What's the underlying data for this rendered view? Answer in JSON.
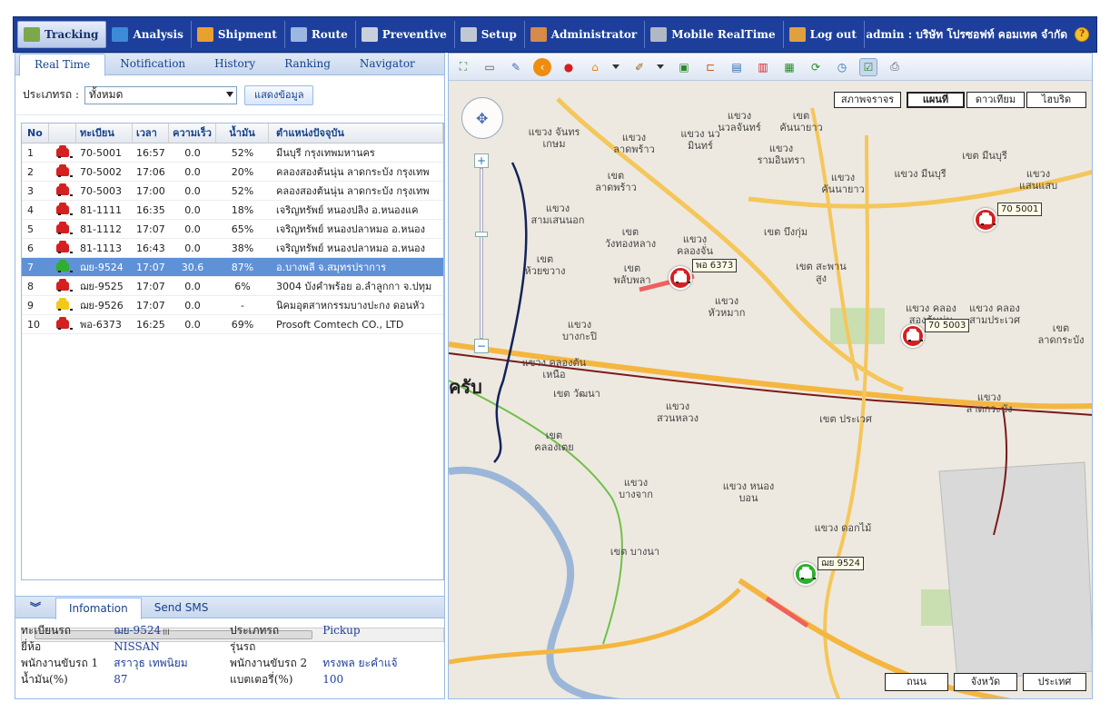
{
  "nav": {
    "items": [
      {
        "label": "Tracking",
        "color": "#7aa84a"
      },
      {
        "label": "Analysis",
        "color": "#3d8bd8"
      },
      {
        "label": "Shipment",
        "color": "#e8a030"
      },
      {
        "label": "Route",
        "color": "#9ab8e0"
      },
      {
        "label": "Preventive",
        "color": "#c8d0dc"
      },
      {
        "label": "Setup",
        "color": "#c0c8d4"
      },
      {
        "label": "Administrator",
        "color": "#d88a4a"
      },
      {
        "label": "Mobile RealTime",
        "color": "#b0b8c4"
      },
      {
        "label": "Log out",
        "color": "#e0a040"
      }
    ],
    "user": "admin : บริษัท โปรซอฟท์ คอมเทค จำกัด"
  },
  "left_tabs": [
    "Real Time",
    "Notification",
    "History",
    "Ranking",
    "Navigator"
  ],
  "filter": {
    "label": "ประเภทรถ :",
    "selected": "ทั้งหมด",
    "button": "แสดงข้อมูล"
  },
  "grid": {
    "headers": [
      "No",
      "",
      "ทะเบียน",
      "เวลา",
      "ความเร็ว",
      "น้ำมัน",
      "ตำแหน่งปัจจุบัน"
    ],
    "rows": [
      {
        "no": "1",
        "color": "#d42020",
        "plate": "70-5001",
        "time": "16:57",
        "speed": "0.0",
        "fuel": "52%",
        "loc": "มีนบุรี กรุงเทพมหานคร"
      },
      {
        "no": "2",
        "color": "#d42020",
        "plate": "70-5002",
        "time": "17:06",
        "speed": "0.0",
        "fuel": "20%",
        "loc": "คลองสองต้นนุ่น ลาดกระบัง กรุงเทพ"
      },
      {
        "no": "3",
        "color": "#d42020",
        "plate": "70-5003",
        "time": "17:00",
        "speed": "0.0",
        "fuel": "52%",
        "loc": "คลองสองต้นนุ่น ลาดกระบัง กรุงเทพ"
      },
      {
        "no": "4",
        "color": "#d42020",
        "plate": "81-1111",
        "time": "16:35",
        "speed": "0.0",
        "fuel": "18%",
        "loc": "เจริญทรัพย์ หนองปลิง อ.หนองแค"
      },
      {
        "no": "5",
        "color": "#d42020",
        "plate": "81-1112",
        "time": "17:07",
        "speed": "0.0",
        "fuel": "65%",
        "loc": "เจริญทรัพย์ หนองปลาหมอ อ.หนอง"
      },
      {
        "no": "6",
        "color": "#d42020",
        "plate": "81-1113",
        "time": "16:43",
        "speed": "0.0",
        "fuel": "38%",
        "loc": "เจริญทรัพย์ หนองปลาหมอ อ.หนอง"
      },
      {
        "no": "7",
        "color": "#2fae2f",
        "plate": "ฌย-9524",
        "time": "17:07",
        "speed": "30.6",
        "fuel": "87%",
        "loc": "อ.บางพลี จ.สมุทรปราการ",
        "selected": true
      },
      {
        "no": "8",
        "color": "#d42020",
        "plate": "ฌย-9525",
        "time": "17:07",
        "speed": "0.0",
        "fuel": "6%",
        "loc": "3004 บังคำพร้อย อ.ลำลูกกา จ.ปทุม"
      },
      {
        "no": "9",
        "color": "#f2c81a",
        "plate": "ฌย-9526",
        "time": "17:07",
        "speed": "0.0",
        "fuel": "-",
        "loc": "นิคมอุตสาหกรรมบางปะกง ดอนหัว"
      },
      {
        "no": "10",
        "color": "#d42020",
        "plate": "พอ-6373",
        "time": "16:25",
        "speed": "0.0",
        "fuel": "69%",
        "loc": "Prosoft Comtech CO., LTD"
      }
    ]
  },
  "scroll_mark": "III",
  "info": {
    "tabs": [
      "Infomation",
      "Send SMS"
    ],
    "rows": [
      [
        {
          "k": "ทะเบียนรถ",
          "v": "ฌย-9524"
        },
        {
          "k": "ประเภทรถ",
          "v": "Pickup"
        }
      ],
      [
        {
          "k": "ยี่ห้อ",
          "v": "NISSAN"
        },
        {
          "k": "รุ่นรถ",
          "v": ""
        }
      ],
      [
        {
          "k": "พนักงานขับรถ 1",
          "v": "สราวุธ เทพนิยม"
        },
        {
          "k": "พนักงานขับรถ 2",
          "v": "ทรงพล ยะคำแจ้"
        }
      ],
      [
        {
          "k": "น้ำมัน(%)",
          "v": "87"
        },
        {
          "k": "แบตเตอรี่(%)",
          "v": "100"
        }
      ]
    ]
  },
  "map": {
    "top_buttons": [
      "สภาพจราจร",
      "แผนที่",
      "ดาวเทียม",
      "ไฮบริด"
    ],
    "bottom_buttons": [
      "ถนน",
      "จังหวัด",
      "ประเทศ"
    ],
    "vehicles": [
      {
        "tag": "70 5001",
        "color": "#d42020"
      },
      {
        "tag": "พอ 6373",
        "color": "#d42020"
      },
      {
        "tag": "70 5003",
        "color": "#d42020"
      },
      {
        "tag": "ฌย 9524",
        "color": "#2fae2f"
      }
    ],
    "places": [
      "แขวง นวลจันทร์",
      "เขต คันนายาว",
      "แขวง จันทรเกษม",
      "แขวง ลาดพร้าว",
      "แขวง นวมินทร์",
      "แขวง รามอินทรา",
      "เขต ลาดพร้าว",
      "แขวง คันนายาว",
      "เขต มีนบุรี",
      "แขวง มีนบุรี",
      "แขวง แสนแสบ",
      "แขวง สามเสนนอก",
      "เขต วังทองหลาง",
      "แขวง คลองจั่น",
      "เขต บึงกุ่ม",
      "เขต ห้วยขวาง",
      "เขต พลับพลา",
      "เขต สะพานสูง",
      "แขวง หัวหมาก",
      "แขวง คลองสองต้นนุ่น",
      "แขวง คลองสามประเวศ",
      "เขต ลาดกระบัง",
      "แขวง บางกะปิ",
      "แขวง คลองต้นเหนือ",
      "เขต วัฒนา",
      "แขวง สวนหลวง",
      "เขต ประเวศ",
      "แขวง ลาดกระบัง",
      "เขต คลองเตย",
      "แขวง บางจาก",
      "แขวง หนองบอน",
      "แขวง ดอกไม้",
      "เขต บางนา",
      "ครับ"
    ]
  }
}
